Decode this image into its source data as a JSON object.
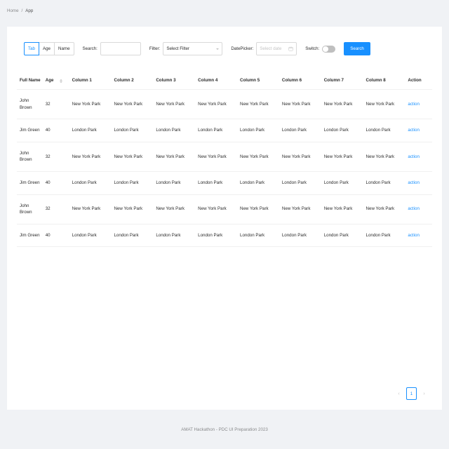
{
  "breadcrumb": {
    "home_label": "Home",
    "separator": "/",
    "current_label": "App"
  },
  "toolbar": {
    "tabs": [
      {
        "label": "Tab",
        "active": true
      },
      {
        "label": "Age",
        "active": false
      },
      {
        "label": "Name",
        "active": false
      }
    ],
    "search_label": "Search:",
    "search_value": "",
    "search_placeholder": "",
    "filter_label": "Filter:",
    "filter_selected": "Select Filter",
    "filter_options": [
      "Select Filter"
    ],
    "datepicker_label": "DatePicker:",
    "datepicker_placeholder": "Select date",
    "datepicker_value": "",
    "calendar_icon": "calendar-icon",
    "switch_label": "Switch:",
    "switch_on": false,
    "search_button_label": "Search",
    "accent_color": "#1890ff"
  },
  "table": {
    "headers": [
      "Full Name",
      "Age",
      "Column 1",
      "Column 2",
      "Column 3",
      "Column 4",
      "Column 5",
      "Column 6",
      "Column 7",
      "Column 8",
      "Action"
    ],
    "sort_icon": "sort-arrows-icon",
    "rows": [
      {
        "name": "John Brown",
        "age": "32",
        "c1": "New York Park",
        "c2": "New York Park",
        "c3": "New York Park",
        "c4": "New York Park",
        "c5": "New York Park",
        "c6": "New York Park",
        "c7": "New York Park",
        "c8": "New York Park",
        "action": "action"
      },
      {
        "name": "Jim Green",
        "age": "40",
        "c1": "London Park",
        "c2": "London Park",
        "c3": "London Park",
        "c4": "London Park",
        "c5": "London Park",
        "c6": "London Park",
        "c7": "London Park",
        "c8": "London Park",
        "action": "action"
      },
      {
        "name": "John Brown",
        "age": "32",
        "c1": "New York Park",
        "c2": "New York Park",
        "c3": "New York Park",
        "c4": "New York Park",
        "c5": "New York Park",
        "c6": "New York Park",
        "c7": "New York Park",
        "c8": "New York Park",
        "action": "action"
      },
      {
        "name": "Jim Green",
        "age": "40",
        "c1": "London Park",
        "c2": "London Park",
        "c3": "London Park",
        "c4": "London Park",
        "c5": "London Park",
        "c6": "London Park",
        "c7": "London Park",
        "c8": "London Park",
        "action": "action"
      },
      {
        "name": "John Brown",
        "age": "32",
        "c1": "New York Park",
        "c2": "New York Park",
        "c3": "New York Park",
        "c4": "New York Park",
        "c5": "New York Park",
        "c6": "New York Park",
        "c7": "New York Park",
        "c8": "New York Park",
        "action": "action"
      },
      {
        "name": "Jim Green",
        "age": "40",
        "c1": "London Park",
        "c2": "London Park",
        "c3": "London Park",
        "c4": "London Park",
        "c5": "London Park",
        "c6": "London Park",
        "c7": "London Park",
        "c8": "London Park",
        "action": "action"
      }
    ]
  },
  "pagination": {
    "prev_glyph": "‹",
    "next_glyph": "›",
    "current_page": "1"
  },
  "footer": {
    "text": "AMAT Hackathon - PDC UI Preparation 2023"
  }
}
